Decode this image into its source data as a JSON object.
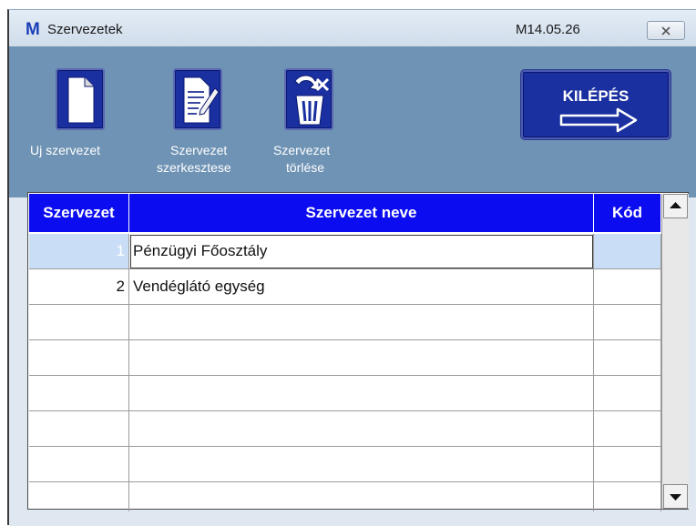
{
  "window": {
    "logo": "M",
    "title": "Szervezetek",
    "version": "M14.05.26",
    "close_icon": "close-icon"
  },
  "toolbar": {
    "new_label": "Uj szervezet",
    "edit_label_line1": "Szervezet",
    "edit_label_line2": "szerkesztese",
    "delete_label_line1": "Szervezet",
    "delete_label_line2": "törlése",
    "exit_label": "KILÉPÉS"
  },
  "grid": {
    "columns": [
      "Szervezet",
      "Szervezet neve",
      "Kód"
    ],
    "rows": [
      {
        "id": "1",
        "name": "Pénzügyi Főosztály",
        "code": ""
      },
      {
        "id": "2",
        "name": "Vendéglátó egység",
        "code": ""
      },
      {
        "id": "",
        "name": "",
        "code": ""
      },
      {
        "id": "",
        "name": "",
        "code": ""
      },
      {
        "id": "",
        "name": "",
        "code": ""
      },
      {
        "id": "",
        "name": "",
        "code": ""
      },
      {
        "id": "",
        "name": "",
        "code": ""
      },
      {
        "id": "",
        "name": "",
        "code": ""
      }
    ],
    "selected_row": 1
  },
  "colors": {
    "header_bg": "#0b0cf0",
    "toolbar_bg": "#6f93b4",
    "button_bg": "#1a2fa0",
    "selected_row_bg": "#c9def6"
  }
}
